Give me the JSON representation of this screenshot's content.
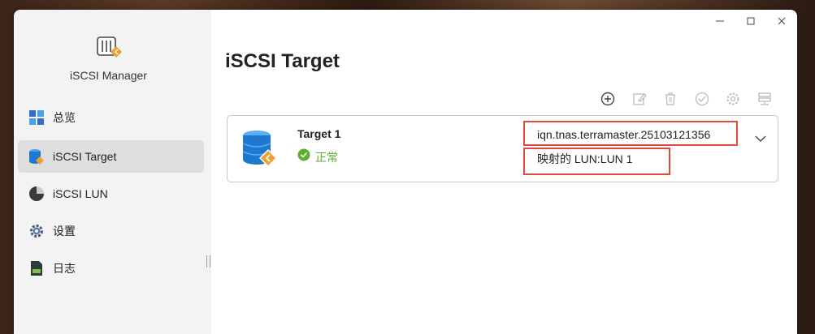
{
  "app": {
    "name": "iSCSI Manager"
  },
  "window_controls": [
    "minimize-icon",
    "maximize-icon",
    "close-icon"
  ],
  "sidebar": {
    "items": [
      {
        "label": "总览",
        "icon": "overview-icon"
      },
      {
        "label": "iSCSI Target",
        "icon": "target-icon",
        "active": true
      },
      {
        "label": "iSCSI LUN",
        "icon": "lun-icon"
      },
      {
        "label": "设置",
        "icon": "gear-icon"
      },
      {
        "label": "日志",
        "icon": "log-icon"
      }
    ]
  },
  "main": {
    "title": "iSCSI Target",
    "toolbar": [
      "add-icon",
      "edit-icon",
      "delete-icon",
      "check-icon",
      "settings-icon",
      "server-icon"
    ],
    "targets": [
      {
        "name": "Target 1",
        "status": "正常",
        "iqn": "iqn.tnas.terramaster.25103121356",
        "lun_mapping": "映射的 LUN:LUN 1"
      }
    ]
  },
  "colors": {
    "status_ok": "#5cb030",
    "highlight": "#e04a3c",
    "accent_blue": "#1e88e5",
    "accent_orange": "#f0a030"
  }
}
